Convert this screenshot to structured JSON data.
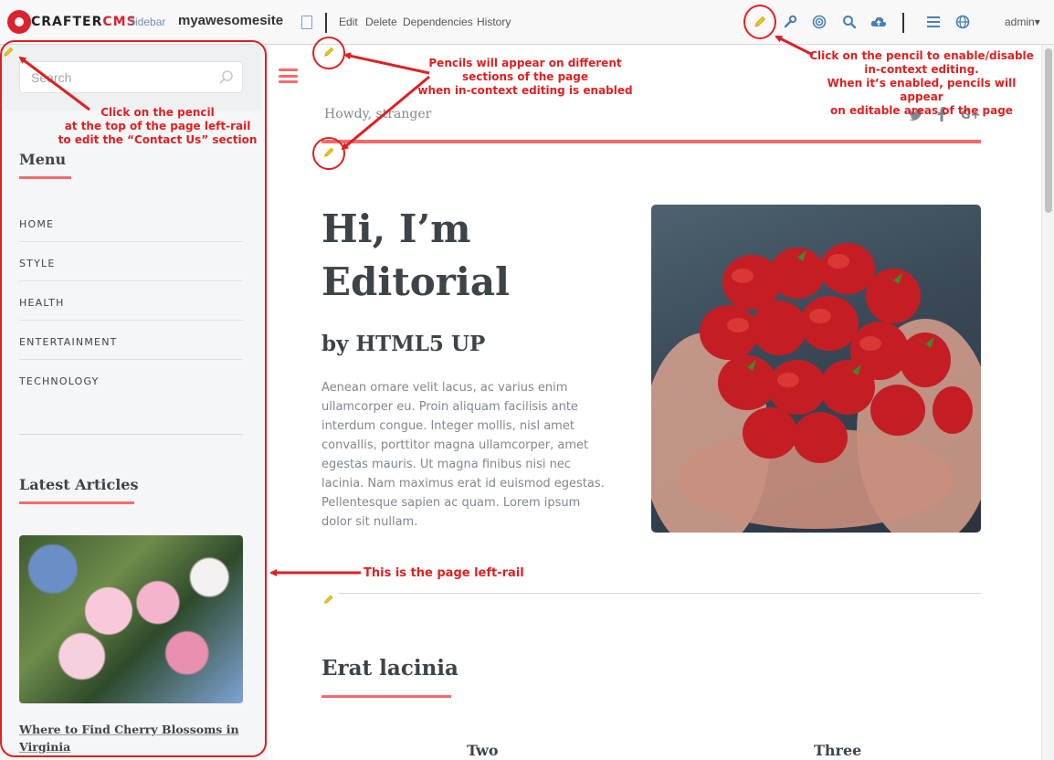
{
  "toolbar": {
    "logo_crafter": "CRAFTER",
    "logo_cms": "CMS",
    "sidebar_label": "Sidebar",
    "site_name": "myawesomesite",
    "actions": [
      "Edit",
      "Delete",
      "Dependencies",
      "History"
    ],
    "user": "admin",
    "icons": [
      "pencil-icon",
      "wrench-icon",
      "target-icon",
      "search-icon",
      "cloud-upload-icon",
      "menu-icon",
      "globe-icon"
    ]
  },
  "left_rail": {
    "search_placeholder": "Search",
    "menu_heading": "Menu",
    "menu_items": [
      "HOME",
      "STYLE",
      "HEALTH",
      "ENTERTAINMENT",
      "TECHNOLOGY"
    ],
    "latest_heading": "Latest Articles",
    "article_title": "Where to Find Cherry Blossoms in Virginia"
  },
  "main": {
    "greeting": "Howdy, stranger",
    "social": [
      "twitter-icon",
      "facebook-icon",
      "google-plus-icon"
    ],
    "hero_title": "Hi, I’m Editorial",
    "hero_subtitle": "by HTML5 UP",
    "hero_body": "Aenean ornare velit lacus, ac varius enim ullamcorper eu. Proin aliquam facilisis ante interdum congue. Integer mollis, nisl amet convallis, porttitor magna ullamcorper, amet egestas mauris. Ut magna finibus nisi nec lacinia. Nam maximus erat id euismod egestas. Pellentesque sapien ac quam. Lorem ipsum dolor sit nullam.",
    "section_title": "Erat lacinia",
    "columns": [
      "Two",
      "Three"
    ]
  },
  "annotations": {
    "rail_pencil_l1": "Click on the pencil",
    "rail_pencil_l2": "at the top of the page left-rail",
    "rail_pencil_l3": "to edit the “Contact Us” section",
    "pencils_l1": "Pencils will appear on different",
    "pencils_l2": "sections of the page",
    "pencils_l3": "when in-context editing is enabled",
    "toggle_l1": "Click on the pencil to enable/disable",
    "toggle_l2": "in-context editing.",
    "toggle_l3": "When it’s enabled, pencils will appear",
    "toggle_l4": "on editable areas of the page",
    "left_rail_label": "This is the page left-rail"
  },
  "colors": {
    "accent": "#f56a6a",
    "annotation": "#e02020",
    "pencil": "#f0c419",
    "toolbar_icon": "#4a7fb5"
  }
}
